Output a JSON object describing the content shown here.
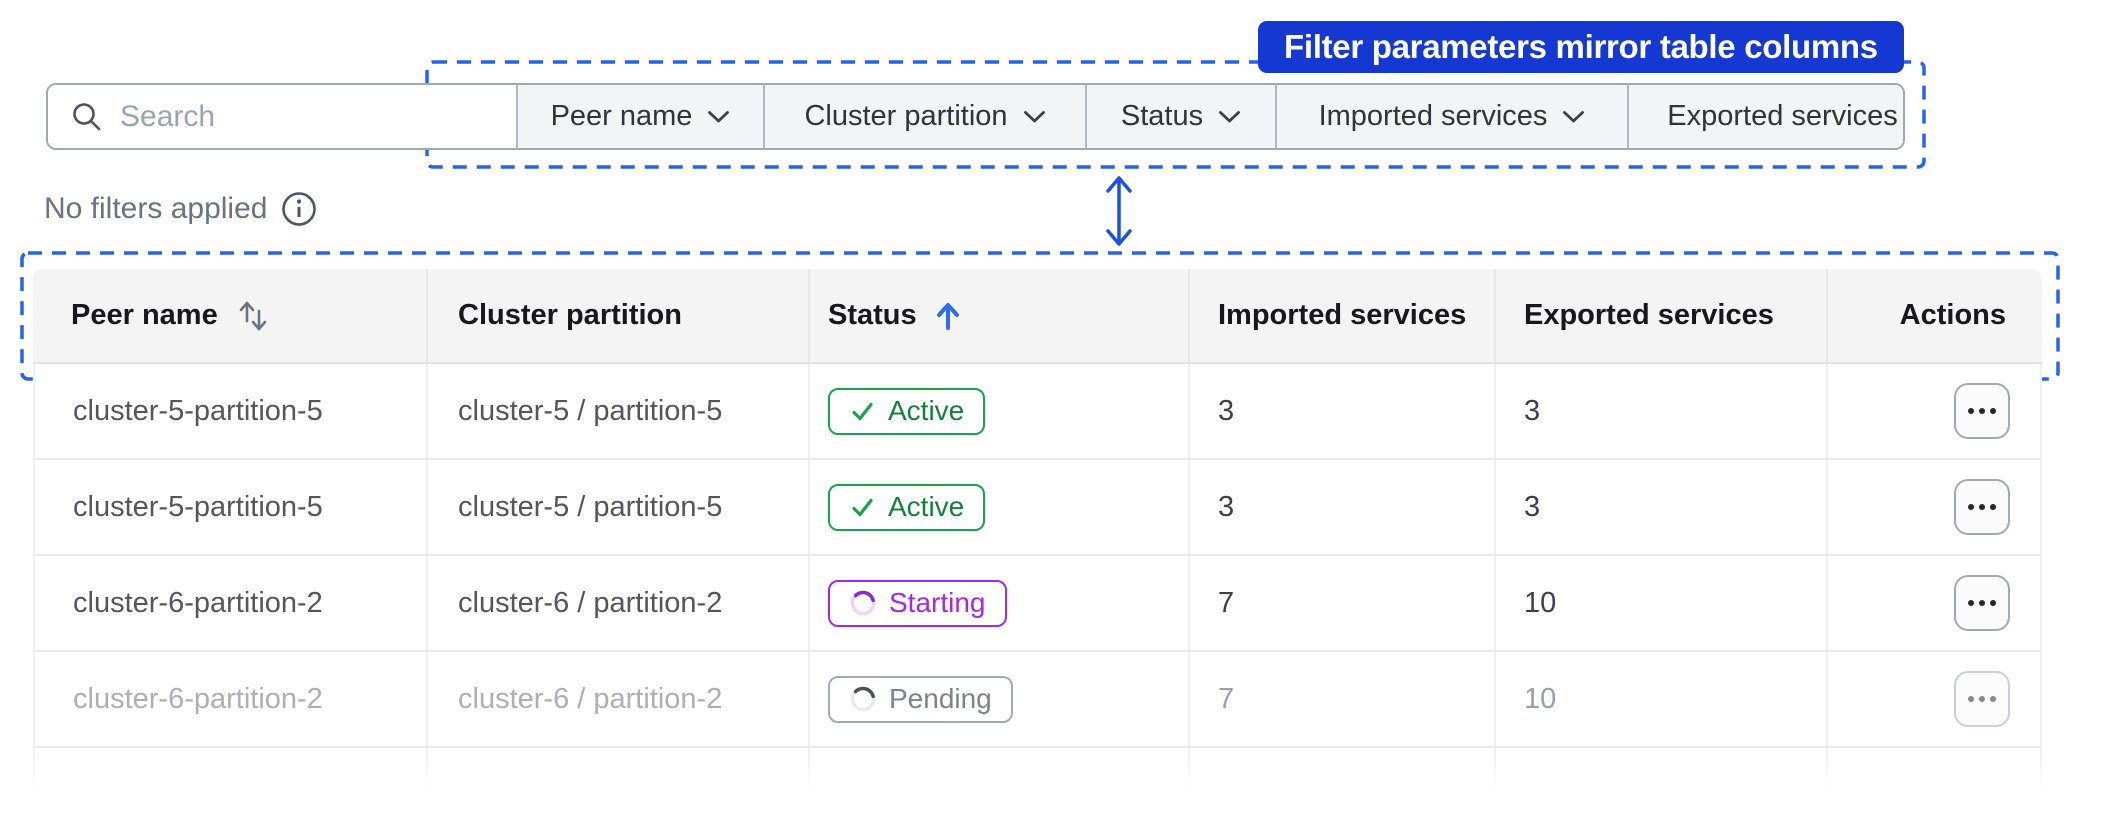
{
  "annotation": {
    "banner_label": "Filter parameters mirror table columns"
  },
  "search": {
    "placeholder": "Search"
  },
  "filter_bar": {
    "filters": [
      {
        "label": "Peer name"
      },
      {
        "label": "Cluster partition"
      },
      {
        "label": "Status"
      },
      {
        "label": "Imported services"
      },
      {
        "label": "Exported services"
      }
    ]
  },
  "filter_status": {
    "text": "No filters applied"
  },
  "table": {
    "columns": [
      {
        "label": "Peer name",
        "sort": "both"
      },
      {
        "label": "Cluster partition",
        "sort": null
      },
      {
        "label": "Status",
        "sort": "asc"
      },
      {
        "label": "Imported services",
        "sort": null
      },
      {
        "label": "Exported services",
        "sort": null
      },
      {
        "label": "Actions",
        "sort": null
      }
    ],
    "rows": [
      {
        "peer_name": "cluster-5-partition-5",
        "cluster_partition": "cluster-5 / partition-5",
        "status_label": "Active",
        "status_variant": "active",
        "imported": "3",
        "exported": "3",
        "faded": false
      },
      {
        "peer_name": "cluster-5-partition-5",
        "cluster_partition": "cluster-5 / partition-5",
        "status_label": "Active",
        "status_variant": "active",
        "imported": "3",
        "exported": "3",
        "faded": false
      },
      {
        "peer_name": "cluster-6-partition-2",
        "cluster_partition": "cluster-6 / partition-2",
        "status_label": "Starting",
        "status_variant": "starting",
        "imported": "7",
        "exported": "10",
        "faded": false
      },
      {
        "peer_name": "cluster-6-partition-2",
        "cluster_partition": "cluster-6 / partition-2",
        "status_label": "Pending",
        "status_variant": "pending",
        "imported": "7",
        "exported": "10",
        "faded": true
      }
    ]
  },
  "icons": {
    "search": "magnifier",
    "info": "circled-i",
    "chevron_down": "⌄",
    "sort_both": "⇅",
    "sort_asc": "↑",
    "check": "✓",
    "spinner": "partial-ring",
    "ellipsis": "⋯",
    "mirror_arrow": "double-headed-vertical-arrow"
  },
  "colors": {
    "banner_blue": "#1638d2",
    "outline_blue": "#2563eb",
    "active_green": "#16a34a",
    "starting_purple": "#a428ec",
    "sort_arrow_blue": "#2f6bf0"
  }
}
